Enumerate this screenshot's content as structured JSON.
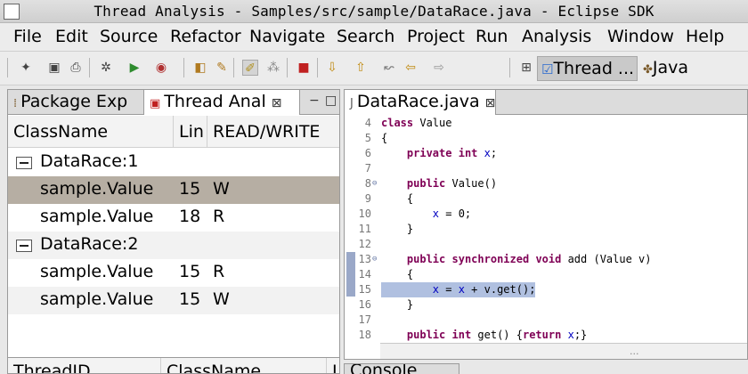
{
  "window": {
    "title": "Thread Analysis - Samples/src/sample/DataRace.java - Eclipse SDK"
  },
  "menu": [
    "File",
    "Edit",
    "Source",
    "Refactor",
    "Navigate",
    "Search",
    "Project",
    "Run",
    "Analysis",
    "Window",
    "Help"
  ],
  "toolbar": {
    "icons": [
      "new-wizard-icon",
      "save-icon",
      "print-icon",
      "debug-icon",
      "run-icon",
      "external-tools-icon",
      "open-type-icon",
      "open-task-icon",
      "highlight-icon",
      "thread-icon",
      "stop-icon",
      "next-annotation-icon",
      "previous-annotation-icon",
      "last-edit-icon",
      "back-icon",
      "forward-icon"
    ],
    "perspectives": {
      "thread_label": "Thread ...",
      "java_label": "Java"
    }
  },
  "left_panel": {
    "tabs": [
      {
        "label": "Package Exp",
        "icon": "package-explorer-icon"
      },
      {
        "label": "Thread Anal",
        "icon": "thread-analysis-icon",
        "active": true
      }
    ],
    "columns": [
      "ClassName",
      "Lin",
      "READ/WRITE"
    ],
    "rows": [
      {
        "type": "group",
        "name": "DataRace:1"
      },
      {
        "type": "item",
        "class": "sample.Value",
        "line": "15",
        "rw": "W",
        "selected": true
      },
      {
        "type": "item",
        "class": "sample.Value",
        "line": "18",
        "rw": "R"
      },
      {
        "type": "group",
        "name": "DataRace:2"
      },
      {
        "type": "item",
        "class": "sample.Value",
        "line": "15",
        "rw": "R"
      },
      {
        "type": "item",
        "class": "sample.Value",
        "line": "15",
        "rw": "W"
      }
    ],
    "bottom_columns": [
      "ThreadID",
      "ClassName",
      "L"
    ]
  },
  "editor": {
    "tab_label": "DataRace.java",
    "lines": [
      {
        "n": "4",
        "text": "class Value"
      },
      {
        "n": "5",
        "text": "{"
      },
      {
        "n": "6",
        "text": "    private int x;"
      },
      {
        "n": "7",
        "text": ""
      },
      {
        "n": "8",
        "text": "    public Value()",
        "fold": true
      },
      {
        "n": "9",
        "text": "    {"
      },
      {
        "n": "10",
        "text": "        x = 0;"
      },
      {
        "n": "11",
        "text": "    }"
      },
      {
        "n": "12",
        "text": ""
      },
      {
        "n": "13",
        "text": "    public synchronized void add (Value v)",
        "fold": true
      },
      {
        "n": "14",
        "text": "    {"
      },
      {
        "n": "15",
        "text": "        x = x + v.get();",
        "highlight": true
      },
      {
        "n": "16",
        "text": "    }"
      },
      {
        "n": "17",
        "text": ""
      },
      {
        "n": "18",
        "text": "    public int get() {return x;}"
      }
    ],
    "scroll_grip": "..."
  },
  "console": {
    "tab_label": "Console"
  }
}
